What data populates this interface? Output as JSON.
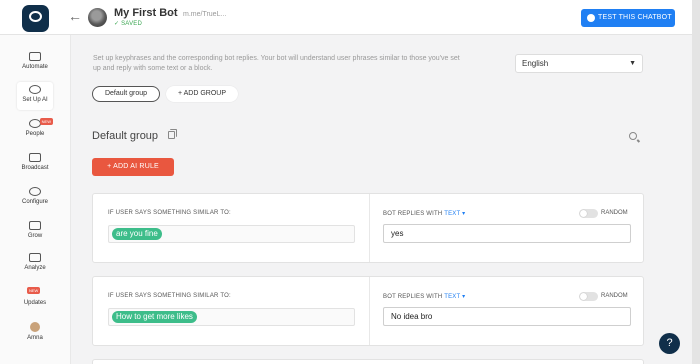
{
  "header": {
    "bot_name": "My First Bot",
    "saved": "SAVED",
    "page_url": "m.me/TrueL...",
    "test_button": "TEST THIS CHATBOT"
  },
  "sidebar": {
    "items": [
      {
        "label": "Automate",
        "icon": "automate-icon"
      },
      {
        "label": "Set Up AI",
        "icon": "ai-icon"
      },
      {
        "label": "People",
        "icon": "people-icon",
        "badge": "NEW"
      },
      {
        "label": "Broadcast",
        "icon": "megaphone-icon"
      },
      {
        "label": "Configure",
        "icon": "gear-icon"
      },
      {
        "label": "Grow",
        "icon": "grow-icon"
      },
      {
        "label": "Analyze",
        "icon": "bar-chart-icon"
      },
      {
        "label": "Updates",
        "icon": "updates-icon",
        "badge": "NEW"
      },
      {
        "label": "Amna",
        "icon": "user-avatar"
      }
    ]
  },
  "main": {
    "description": "Set up keyphrases and the corresponding bot replies. Your bot will understand user phrases similar to those you've set up and reply with some text or a block.",
    "language": "English",
    "group_tab": "Default group",
    "add_group": "ADD GROUP",
    "group_title": "Default group",
    "add_rule": "ADD AI RULE",
    "user_label": "IF USER SAYS SOMETHING SIMILAR TO:",
    "bot_label": "BOT REPLIES WITH",
    "bot_label_type": "TEXT",
    "random_label": "RANDOM",
    "rules": [
      {
        "phrase": "are you fine",
        "reply": "yes"
      },
      {
        "phrase": "How to get more likes",
        "reply": "No idea bro"
      }
    ]
  },
  "help": "?",
  "colors": {
    "accent_blue": "#1f7ff3",
    "danger_red": "#e9573f",
    "phrase_green": "#3dbd8a",
    "logo_navy": "#102f4a"
  }
}
